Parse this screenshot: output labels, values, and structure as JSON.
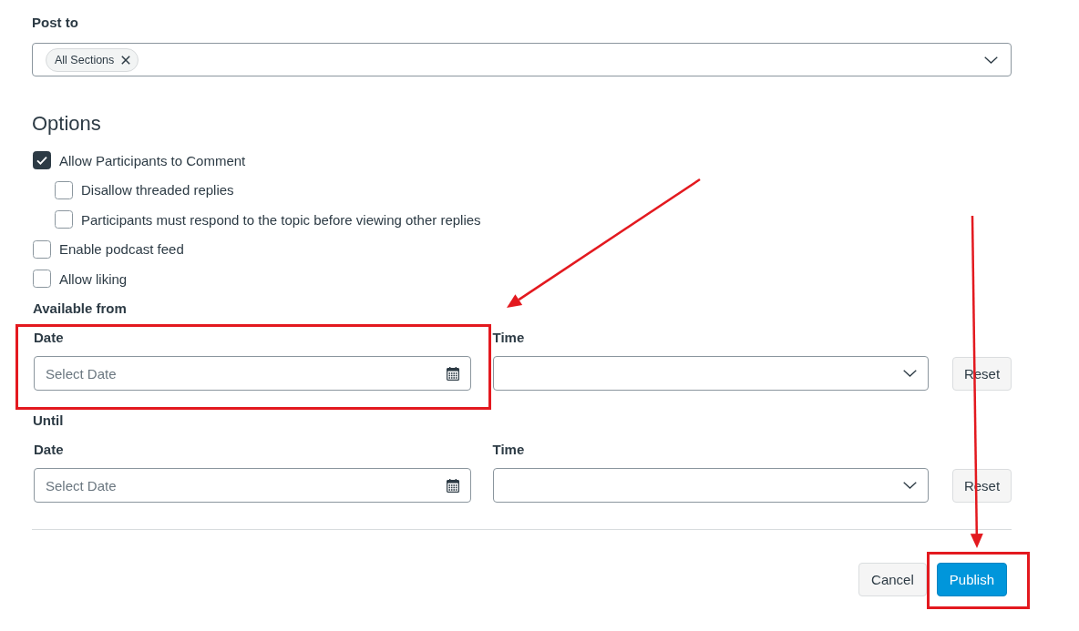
{
  "post_to": {
    "label": "Post to",
    "chips": [
      {
        "label": "All Sections"
      }
    ]
  },
  "options": {
    "heading": "Options",
    "checkboxes": [
      {
        "label": "Allow Participants to Comment",
        "checked": true,
        "children": [
          {
            "label": "Disallow threaded replies",
            "checked": false
          },
          {
            "label": "Participants must respond to the topic before viewing other replies",
            "checked": false
          }
        ]
      },
      {
        "label": "Enable podcast feed",
        "checked": false
      },
      {
        "label": "Allow liking",
        "checked": false
      }
    ]
  },
  "availability": [
    {
      "heading": "Available from",
      "date": {
        "label": "Date",
        "placeholder": "Select Date"
      },
      "time": {
        "label": "Time"
      },
      "reset": "Reset"
    },
    {
      "heading": "Until",
      "date": {
        "label": "Date",
        "placeholder": "Select Date"
      },
      "time": {
        "label": "Time"
      },
      "reset": "Reset"
    }
  ],
  "buttons": [
    {
      "label": "Cancel",
      "kind": "secondary"
    },
    {
      "label": "Publish",
      "kind": "primary"
    }
  ]
}
